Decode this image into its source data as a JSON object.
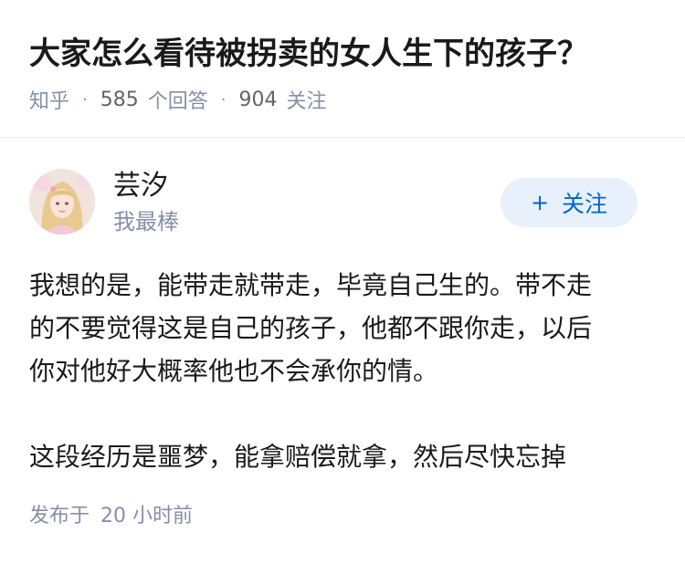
{
  "question": {
    "title": "大家怎么看待被拐卖的女人生下的孩子？"
  },
  "meta": {
    "source": "知乎",
    "separator": "·",
    "answer_count": "585",
    "answer_label": "个回答",
    "follower_count": "904",
    "follower_label": "关注"
  },
  "author": {
    "name": "芸汐",
    "bio": "我最棒",
    "avatar_icon": "avatar-portrait"
  },
  "follow_button": {
    "icon": "plus-icon",
    "plus": "+",
    "label": "关注"
  },
  "answer": {
    "lines": [
      "我想的是，能带走就带走，毕竟自己生的。带不走",
      "的不要觉得这是自己的孩子，他都不跟你走，以后",
      "你对他好大概率他也不会承你的情。",
      "这段经历是噩梦，能拿赔偿就拿，然后尽快忘掉"
    ]
  },
  "publish": {
    "label": "发布于",
    "time": "20 小时前"
  },
  "colors": {
    "title": "#1a1a1a",
    "meta": "#8590a6",
    "follow_bg": "#e8f1fb",
    "follow_text": "#0066cc",
    "divider": "#ececec"
  }
}
